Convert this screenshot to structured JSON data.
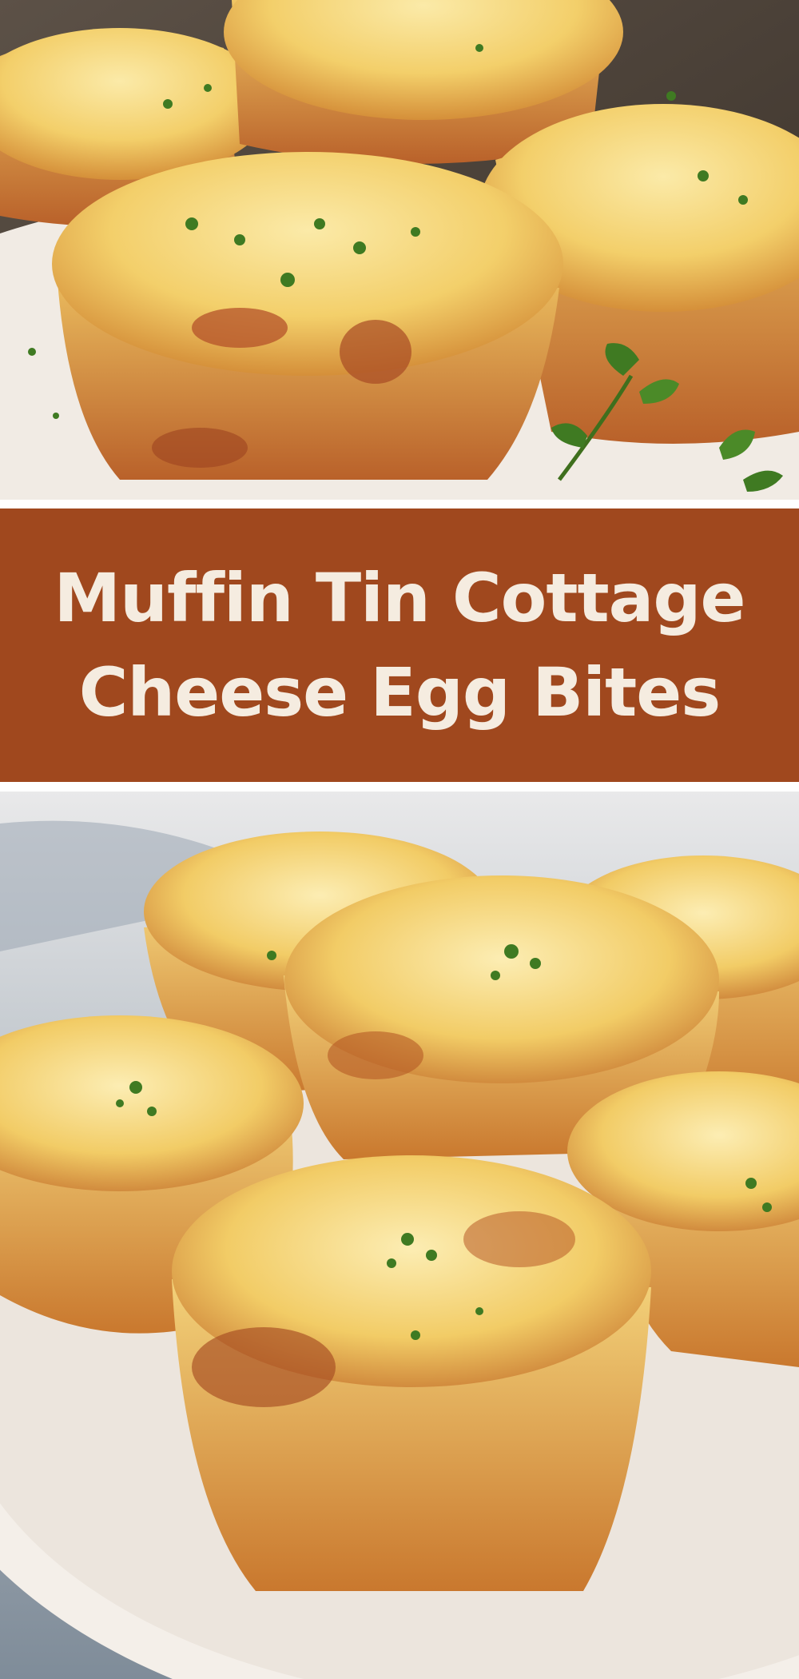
{
  "title": {
    "line1": "Muffin Tin Cottage",
    "line2": "Cheese Egg Bites"
  },
  "colors": {
    "banner": "#a0481e",
    "title_text": "#f5ece0",
    "crust": "#c8742a",
    "egg": "#f3cf6a",
    "plate": "#f4efe9",
    "parsley": "#3f7a22",
    "tablecloth": "#8a98a6"
  },
  "photos": {
    "top": "close-up of golden baked egg bites with parsley on a white plate",
    "bottom": "egg bites stacked on a white plate over a blue-grey cloth"
  }
}
